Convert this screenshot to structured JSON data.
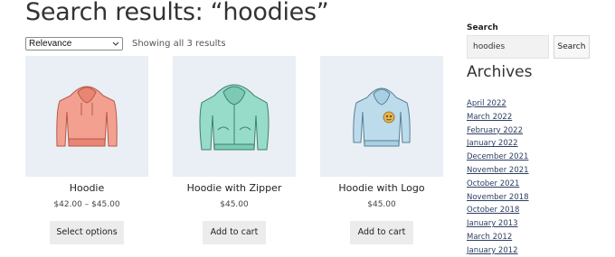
{
  "page_title": "Search results: “hoodies”",
  "ordering": {
    "selected": "Relevance"
  },
  "result_count": "Showing all 3 results",
  "products": [
    {
      "name": "Hoodie",
      "price": "$42.00 – $45.00",
      "button": "Select options",
      "color": "#f4a090"
    },
    {
      "name": "Hoodie with Zipper",
      "price": "$45.00",
      "button": "Add to cart",
      "color": "#96dcc8"
    },
    {
      "name": "Hoodie with Logo",
      "price": "$45.00",
      "button": "Add to cart",
      "color": "#bcdcec"
    }
  ],
  "sidebar": {
    "search_label": "Search",
    "search_value": "hoodies",
    "search_button": "Search",
    "archives_title": "Archives",
    "archives": [
      "April 2022",
      "March 2022",
      "February 2022",
      "January 2022",
      "December 2021",
      "November 2021",
      "October 2021",
      "November 2018",
      "October 2018",
      "January 2013",
      "March 2012",
      "January 2012"
    ]
  }
}
